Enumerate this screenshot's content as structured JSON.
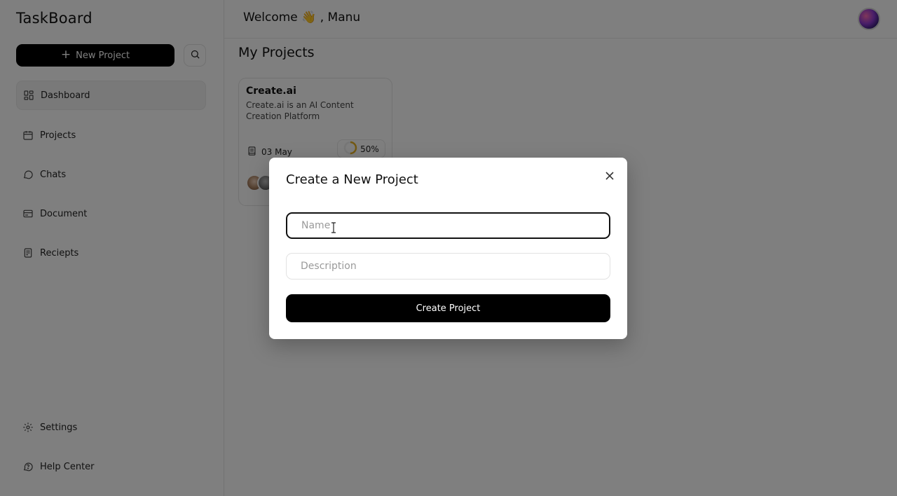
{
  "app": {
    "title": "TaskBoard"
  },
  "header": {
    "welcome_text": "Welcome 👋 , Manu"
  },
  "sidebar": {
    "new_project_label": "New Project",
    "items": [
      {
        "label": "Dashboard",
        "icon": "dashboard-icon",
        "active": true
      },
      {
        "label": "Projects",
        "icon": "calendar-icon",
        "active": false
      },
      {
        "label": "Chats",
        "icon": "chat-icon",
        "active": false
      },
      {
        "label": "Document",
        "icon": "document-icon",
        "active": false
      },
      {
        "label": "Reciepts",
        "icon": "receipt-icon",
        "active": false
      }
    ],
    "bottom_items": [
      {
        "label": "Settings",
        "icon": "gear-icon"
      },
      {
        "label": "Help Center",
        "icon": "help-icon"
      }
    ]
  },
  "main": {
    "section_title": "My Projects",
    "projects": [
      {
        "title": "Create.ai",
        "description": "Create.ai is an AI Content Creation Platform",
        "date": "03 May",
        "progress_label": "50%",
        "progress": 0.5
      }
    ]
  },
  "modal": {
    "title": "Create a New Project",
    "name_placeholder": "Name",
    "name_value": "",
    "description_placeholder": "Description",
    "description_value": "",
    "submit_label": "Create Project"
  },
  "colors": {
    "accent": "#000000",
    "overlay": "#808080",
    "progress_ring": "#e7b325"
  }
}
